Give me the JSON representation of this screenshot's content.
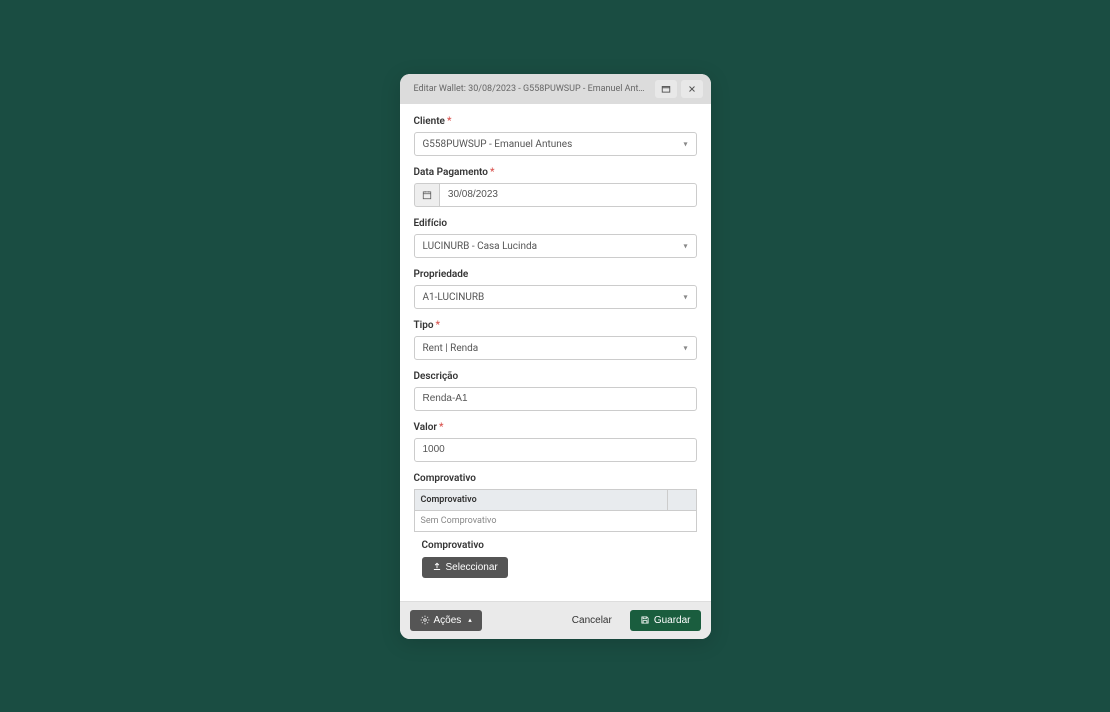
{
  "header": {
    "title": "Editar Wallet: 30/08/2023 - G558PUWSUP - Emanuel Antunes - ..."
  },
  "form": {
    "cliente": {
      "label": "Cliente",
      "value": "G558PUWSUP - Emanuel Antunes"
    },
    "data_pagamento": {
      "label": "Data Pagamento",
      "value": "30/08/2023"
    },
    "edificio": {
      "label": "Edifício",
      "value": "LUCINURB - Casa Lucinda"
    },
    "propriedade": {
      "label": "Propriedade",
      "value": "A1-LUCINURB"
    },
    "tipo": {
      "label": "Tipo",
      "value": "Rent | Renda"
    },
    "descricao": {
      "label": "Descrição",
      "value": "Renda-A1"
    },
    "valor": {
      "label": "Valor",
      "value": "1000"
    },
    "comprovativo": {
      "label": "Comprovativo",
      "table_header": "Comprovativo",
      "empty_text": "Sem Comprovativo",
      "upload_label": "Comprovativo",
      "select_btn": "Seleccionar"
    }
  },
  "footer": {
    "actions": "Ações",
    "cancel": "Cancelar",
    "save": "Guardar"
  }
}
